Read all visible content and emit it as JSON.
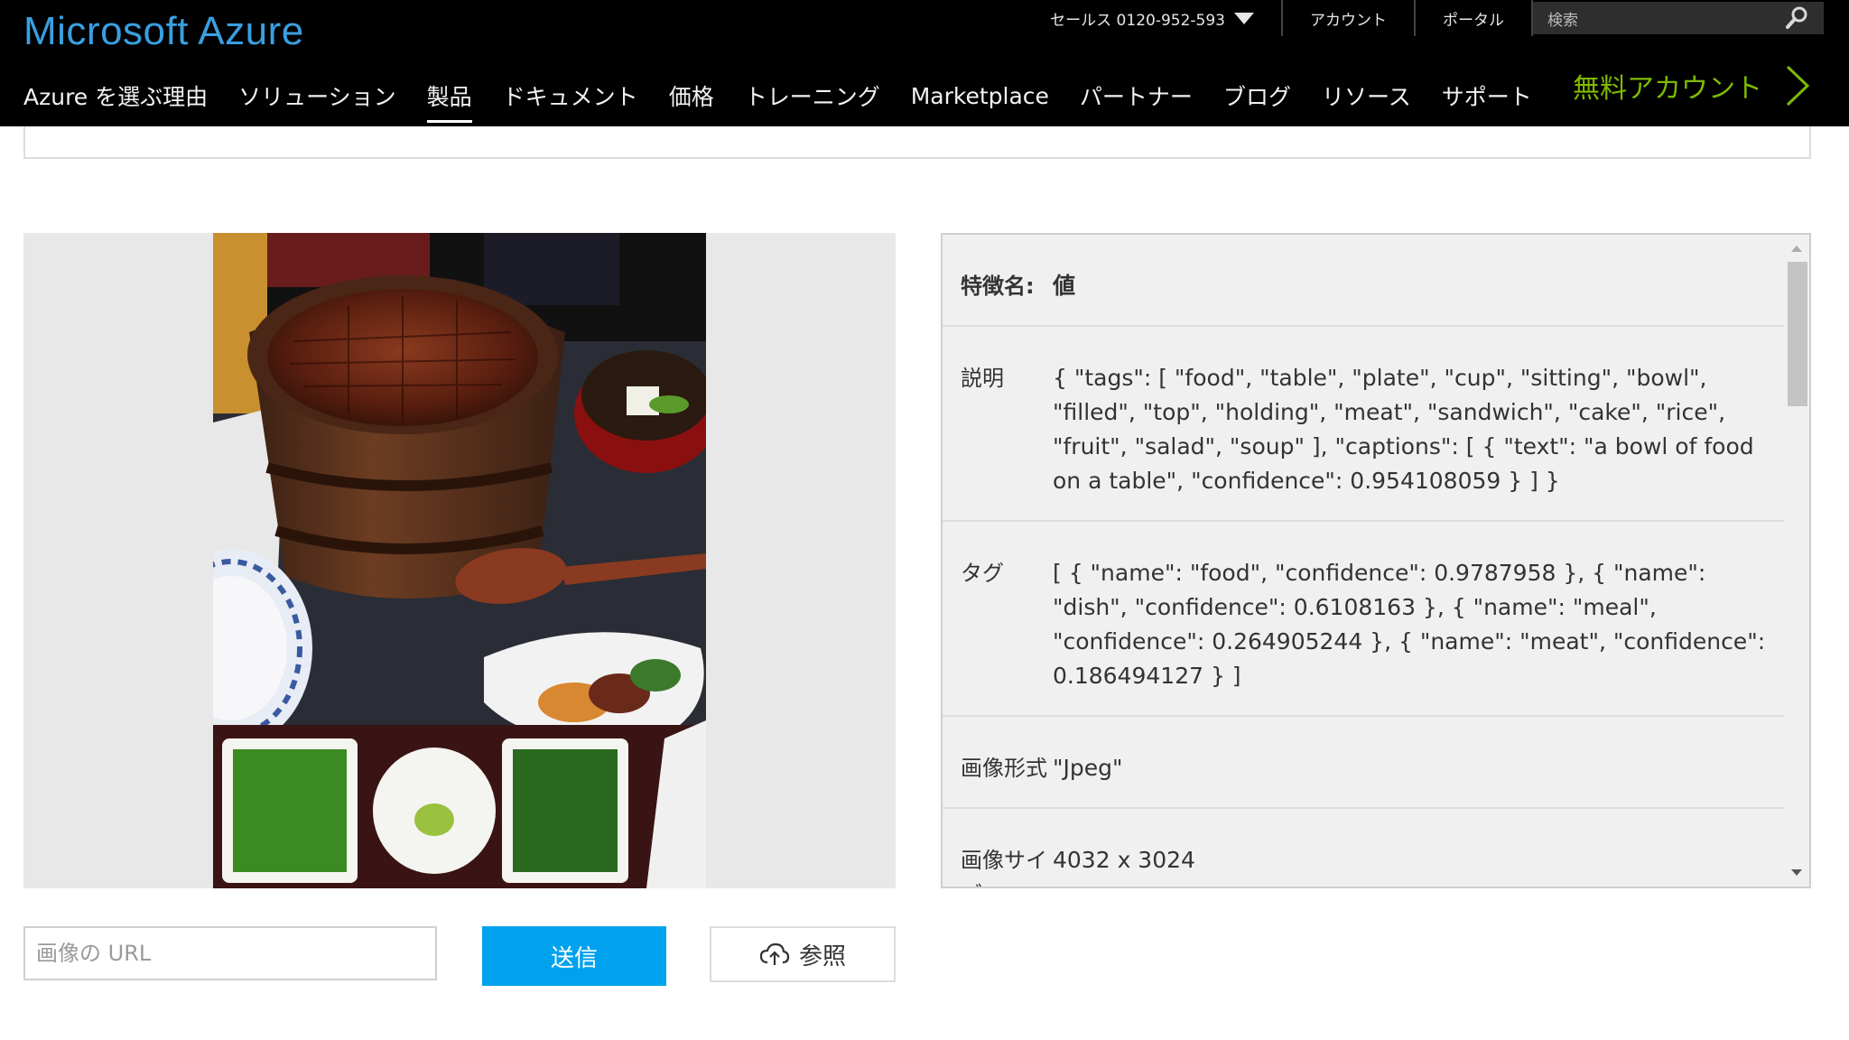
{
  "header": {
    "logo": "Microsoft Azure",
    "sales": "セールス 0120-952-593",
    "account": "アカウント",
    "portal": "ポータル",
    "search_placeholder": "検索",
    "free_account": "無料アカウント",
    "nav": [
      {
        "label": "Azure を選ぶ理由"
      },
      {
        "label": "ソリューション"
      },
      {
        "label": "製品"
      },
      {
        "label": "ドキュメント"
      },
      {
        "label": "価格"
      },
      {
        "label": "トレーニング"
      },
      {
        "label": "Marketplace"
      },
      {
        "label": "パートナー"
      },
      {
        "label": "ブログ"
      },
      {
        "label": "リソース"
      },
      {
        "label": "サポート"
      }
    ]
  },
  "results": {
    "header_key": "特徴名:",
    "header_value": "値",
    "rows": [
      {
        "key": "説明",
        "value": "{ \"tags\": [ \"food\", \"table\", \"plate\", \"cup\", \"sitting\", \"bowl\", \"filled\", \"top\", \"holding\", \"meat\", \"sandwich\", \"cake\", \"rice\", \"fruit\", \"salad\", \"soup\" ], \"captions\": [ { \"text\": \"a bowl of food on a table\", \"confidence\": 0.954108059 } ] }"
      },
      {
        "key": "タグ",
        "value": "[ { \"name\": \"food\", \"confidence\": 0.9787958 }, { \"name\": \"dish\", \"confidence\": 0.6108163 }, { \"name\": \"meal\", \"confidence\": 0.264905244 }, { \"name\": \"meat\", \"confidence\": 0.186494127 } ]"
      },
      {
        "key": "画像形式",
        "value": "\"Jpeg\""
      },
      {
        "key": "画像サイズ",
        "value": "4032 x 3024"
      }
    ]
  },
  "controls": {
    "url_placeholder": "画像の URL",
    "send_label": "送信",
    "browse_label": "参照"
  },
  "colors": {
    "logo": "#3a9fe0",
    "free_account": "#7fba00",
    "send_button": "#00a2ed"
  }
}
